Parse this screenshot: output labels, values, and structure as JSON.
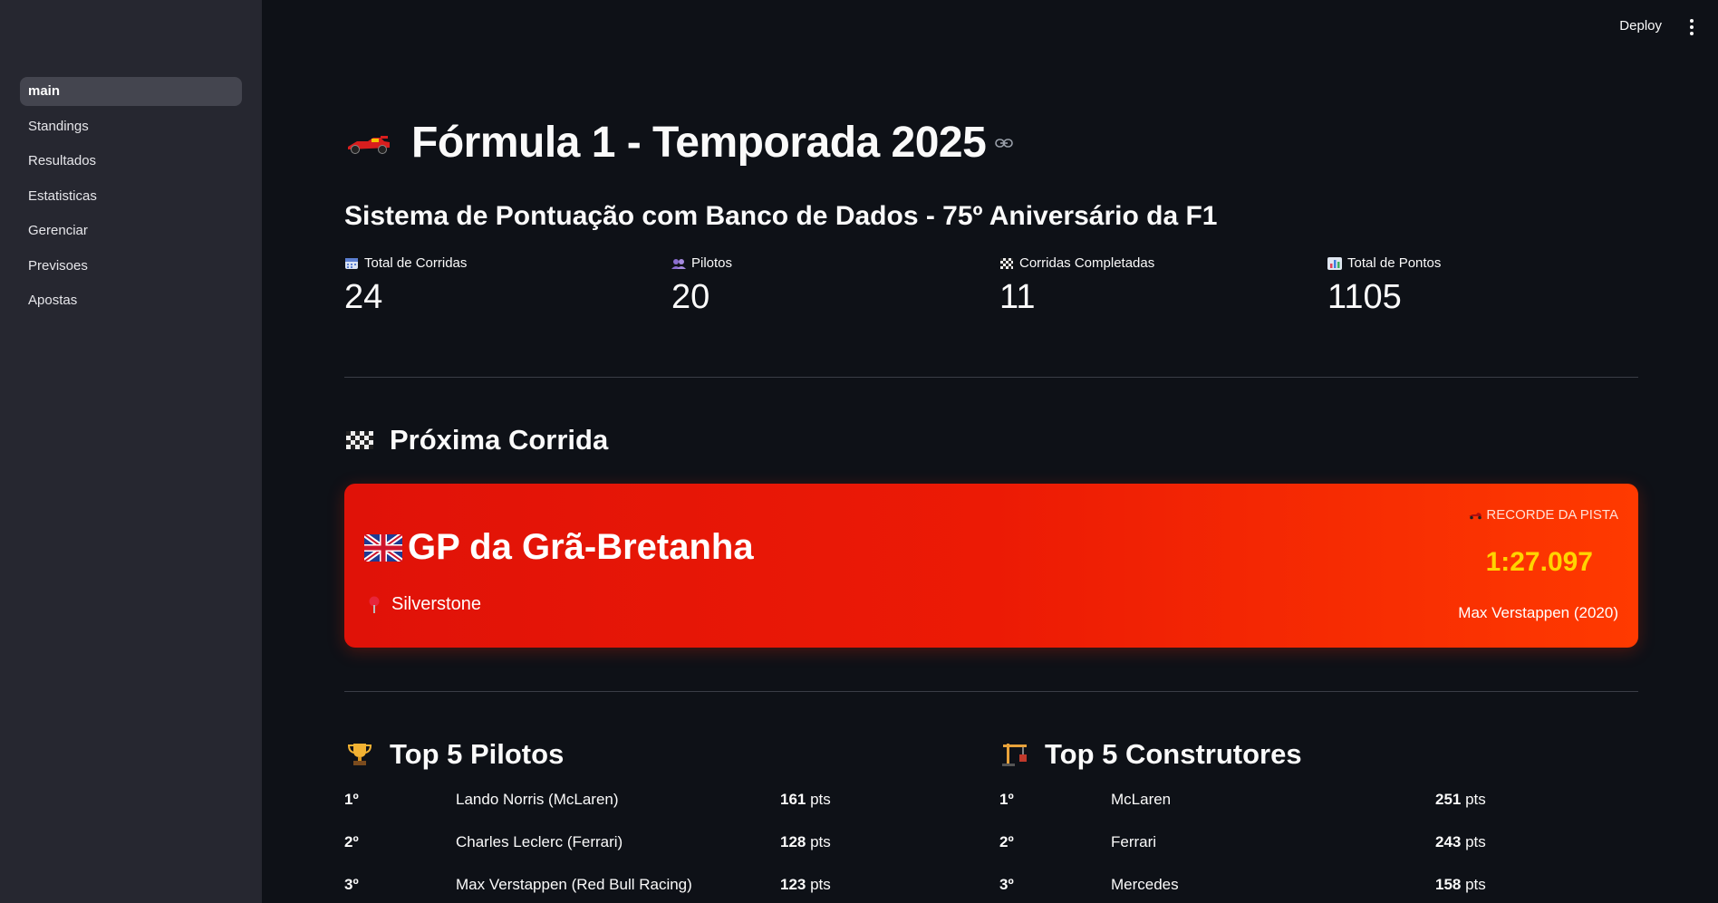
{
  "sidebar": {
    "items": [
      {
        "label": "main"
      },
      {
        "label": "Standings"
      },
      {
        "label": "Resultados"
      },
      {
        "label": "Estatisticas"
      },
      {
        "label": "Gerenciar"
      },
      {
        "label": "Previsoes"
      },
      {
        "label": "Apostas"
      }
    ]
  },
  "header": {
    "deploy_label": "Deploy"
  },
  "page": {
    "title": "Fórmula 1 - Temporada 2025",
    "subtitle": "Sistema de Pontuação com Banco de Dados - 75º Aniversário da F1"
  },
  "metrics": [
    {
      "label": "Total de Corridas",
      "value": "24",
      "icon": "calendar-icon"
    },
    {
      "label": "Pilotos",
      "value": "20",
      "icon": "people-icon"
    },
    {
      "label": "Corridas Completadas",
      "value": "11",
      "icon": "checkered-flag-icon"
    },
    {
      "label": "Total de Pontos",
      "value": "1105",
      "icon": "bar-chart-icon"
    }
  ],
  "next_race": {
    "section_title": "Próxima Corrida",
    "name": "GP da Grã-Bretanha",
    "location": "Silverstone",
    "record_label": "RECORDE DA PISTA",
    "record_time": "1:27.097",
    "record_holder": "Max Verstappen (2020)"
  },
  "top_drivers": {
    "title": "Top 5 Pilotos",
    "rows": [
      {
        "pos": "1º",
        "name": "Lando Norris (McLaren)",
        "pts": "161",
        "unit": " pts"
      },
      {
        "pos": "2º",
        "name": "Charles Leclerc (Ferrari)",
        "pts": "128",
        "unit": " pts"
      },
      {
        "pos": "3º",
        "name": "Max Verstappen (Red Bull Racing)",
        "pts": "123",
        "unit": " pts"
      }
    ]
  },
  "top_constructors": {
    "title": "Top 5 Construtores",
    "rows": [
      {
        "pos": "1º",
        "name": "McLaren",
        "pts": "251",
        "unit": " pts"
      },
      {
        "pos": "2º",
        "name": "Ferrari",
        "pts": "243",
        "unit": " pts"
      },
      {
        "pos": "3º",
        "name": "Mercedes",
        "pts": "158",
        "unit": " pts"
      }
    ]
  },
  "colors": {
    "background": "#0e1117",
    "sidebar": "#262730",
    "card_start": "#e01208",
    "card_end": "#ff3a00",
    "record_time": "#ffd400"
  }
}
